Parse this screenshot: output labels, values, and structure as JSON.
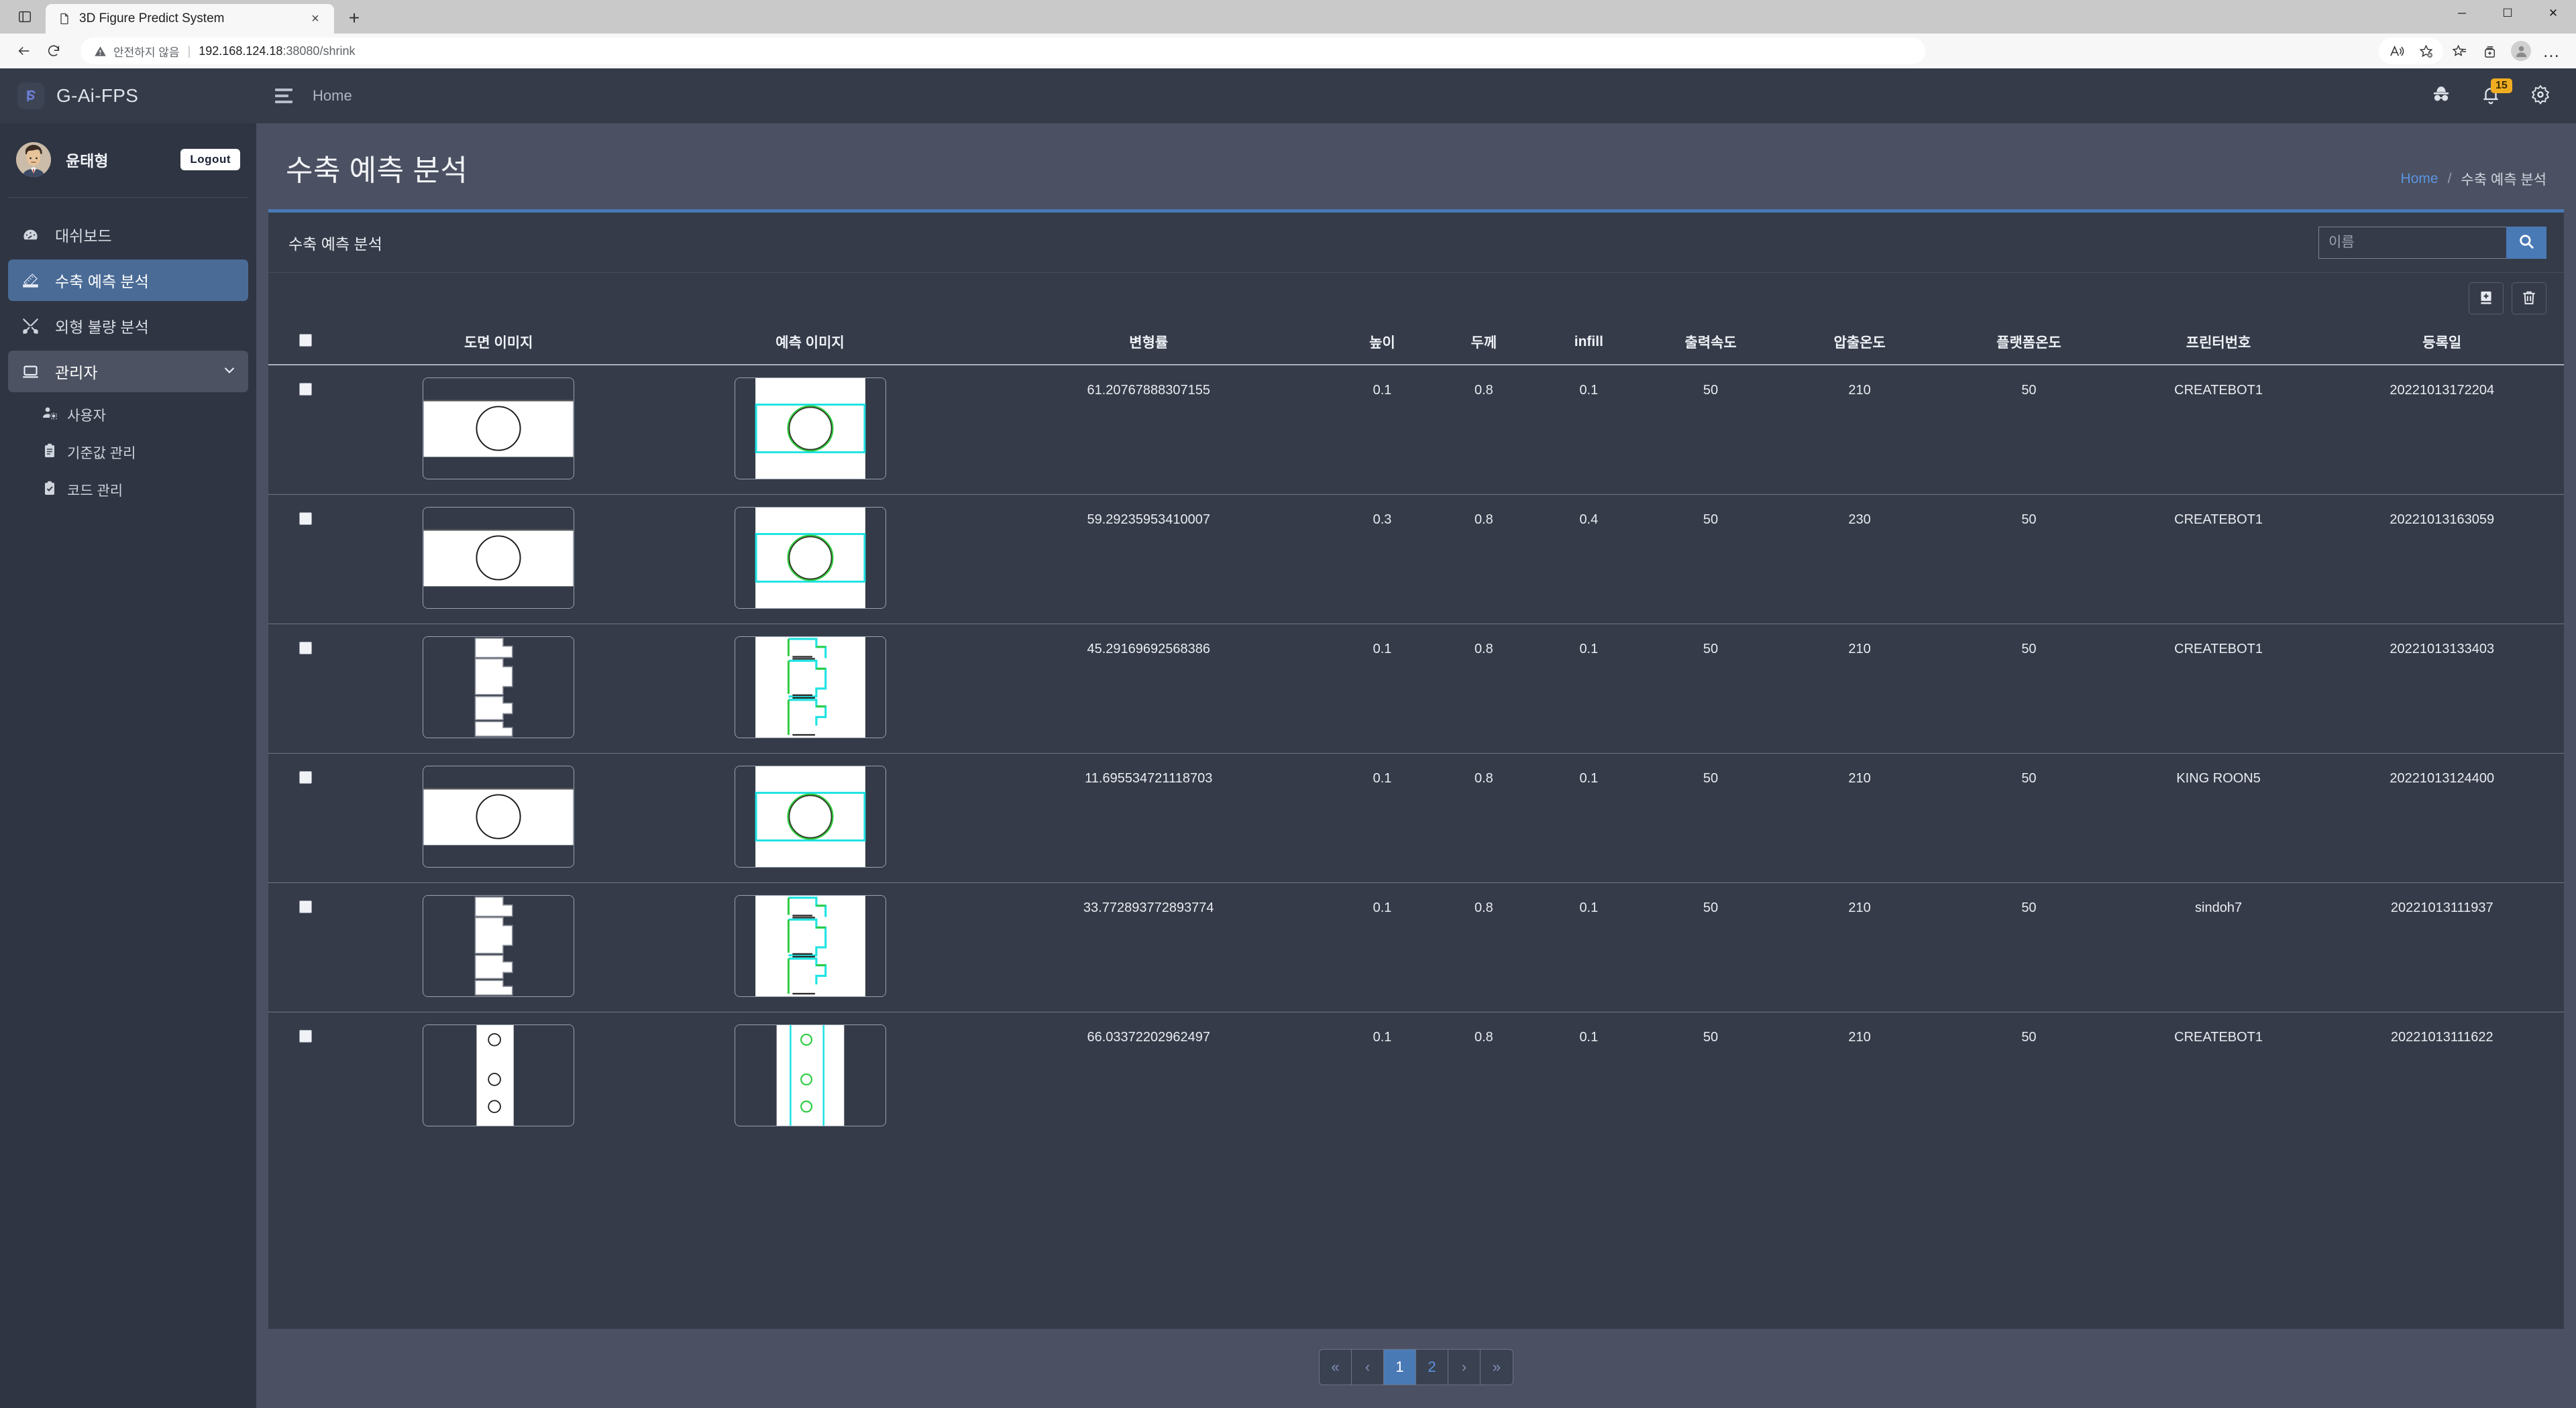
{
  "browser": {
    "tab_title": "3D Figure Predict System",
    "tab_close": "×",
    "new_tab": "+",
    "window_minimize": "─",
    "window_maximize": "☐",
    "window_close": "✕",
    "not_secure_label": "안전하지 않음",
    "url_divider": "|",
    "url_host": "192.168.124.18",
    "url_path": ":38080/shrink",
    "more_menu": "…"
  },
  "sidebar": {
    "brand": "G-Ai-FPS",
    "user_name": "윤태형",
    "logout_label": "Logout",
    "items": [
      {
        "label": "대쉬보드",
        "icon": "dashboard-icon",
        "active": false
      },
      {
        "label": "수축 예측 분석",
        "icon": "ruler-icon",
        "active": true
      },
      {
        "label": "외형 불량 분석",
        "icon": "tools-icon",
        "active": false
      },
      {
        "label": "관리자",
        "icon": "laptop-icon",
        "active": false,
        "expanded": true
      }
    ],
    "sub_items": [
      {
        "label": "사용자",
        "icon": "user-gear-icon"
      },
      {
        "label": "기준값 관리",
        "icon": "clipboard-icon"
      },
      {
        "label": "코드 관리",
        "icon": "clipboard-check-icon"
      }
    ]
  },
  "topbar": {
    "home_label": "Home",
    "notification_count": "15"
  },
  "page": {
    "title": "수축 예측 분석",
    "breadcrumb_home": "Home",
    "breadcrumb_sep": "/",
    "breadcrumb_current": "수축 예측 분석"
  },
  "card": {
    "title": "수축 예측 분석",
    "search_placeholder": "이름",
    "search_value": ""
  },
  "table": {
    "columns": [
      "도면 이미지",
      "예측 이미지",
      "변형률",
      "높이",
      "두께",
      "infill",
      "출력속도",
      "압출온도",
      "플랫폼온도",
      "프린터번호",
      "등록일"
    ],
    "rows": [
      {
        "drawing": "rect-circle",
        "predict": "rect-circle-pred",
        "strain": "61.20767888307155",
        "height": "0.1",
        "thickness": "0.8",
        "infill": "0.1",
        "speed": "50",
        "nozzle_temp": "210",
        "bed_temp": "50",
        "printer": "CREATEBOT1",
        "registered": "20221013172204"
      },
      {
        "drawing": "rect-circle",
        "predict": "rect-circle-pred",
        "strain": "59.29235953410007",
        "height": "0.3",
        "thickness": "0.8",
        "infill": "0.4",
        "speed": "50",
        "nozzle_temp": "230",
        "bed_temp": "50",
        "printer": "CREATEBOT1",
        "registered": "20221013163059"
      },
      {
        "drawing": "step-profile",
        "predict": "step-profile-pred",
        "strain": "45.29169692568386",
        "height": "0.1",
        "thickness": "0.8",
        "infill": "0.1",
        "speed": "50",
        "nozzle_temp": "210",
        "bed_temp": "50",
        "printer": "CREATEBOT1",
        "registered": "20221013133403"
      },
      {
        "drawing": "rect-circle",
        "predict": "rect-circle-pred",
        "strain": "11.695534721118703",
        "height": "0.1",
        "thickness": "0.8",
        "infill": "0.1",
        "speed": "50",
        "nozzle_temp": "210",
        "bed_temp": "50",
        "printer": "KING ROON5",
        "registered": "20221013124400"
      },
      {
        "drawing": "step-profile",
        "predict": "step-profile-pred",
        "strain": "33.772893772893774",
        "height": "0.1",
        "thickness": "0.8",
        "infill": "0.1",
        "speed": "50",
        "nozzle_temp": "210",
        "bed_temp": "50",
        "printer": "sindoh7",
        "registered": "20221013111937"
      },
      {
        "drawing": "hole-strip",
        "predict": "hole-strip-pred",
        "strain": "66.03372202962497",
        "height": "0.1",
        "thickness": "0.8",
        "infill": "0.1",
        "speed": "50",
        "nozzle_temp": "210",
        "bed_temp": "50",
        "printer": "CREATEBOT1",
        "registered": "20221013111622"
      }
    ]
  },
  "pagination": {
    "first": "«",
    "prev": "‹",
    "pages": [
      "1",
      "2"
    ],
    "current": "1",
    "next": "›",
    "last": "»"
  },
  "colors": {
    "accent": "#4a7ab5",
    "sidebar_bg": "#2f3542",
    "card_bg": "#353b48",
    "main_bg": "#4b5162",
    "link": "#5b93e0",
    "badge": "#f0ad21",
    "thumb_green": "#2ecc40",
    "thumb_cyan": "#1fe3e3"
  }
}
